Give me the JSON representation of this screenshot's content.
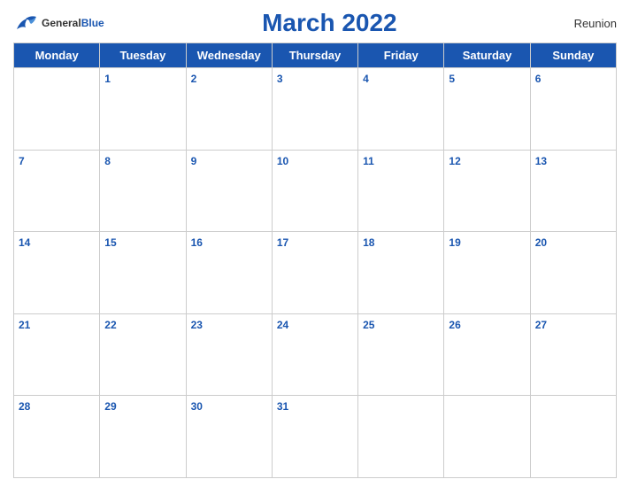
{
  "header": {
    "logo_general": "General",
    "logo_blue": "Blue",
    "title": "March 2022",
    "region": "Reunion"
  },
  "days_of_week": [
    "Monday",
    "Tuesday",
    "Wednesday",
    "Thursday",
    "Friday",
    "Saturday",
    "Sunday"
  ],
  "weeks": [
    [
      "",
      "1",
      "2",
      "3",
      "4",
      "5",
      "6"
    ],
    [
      "7",
      "8",
      "9",
      "10",
      "11",
      "12",
      "13"
    ],
    [
      "14",
      "15",
      "16",
      "17",
      "18",
      "19",
      "20"
    ],
    [
      "21",
      "22",
      "23",
      "24",
      "25",
      "26",
      "27"
    ],
    [
      "28",
      "29",
      "30",
      "31",
      "",
      "",
      ""
    ]
  ]
}
